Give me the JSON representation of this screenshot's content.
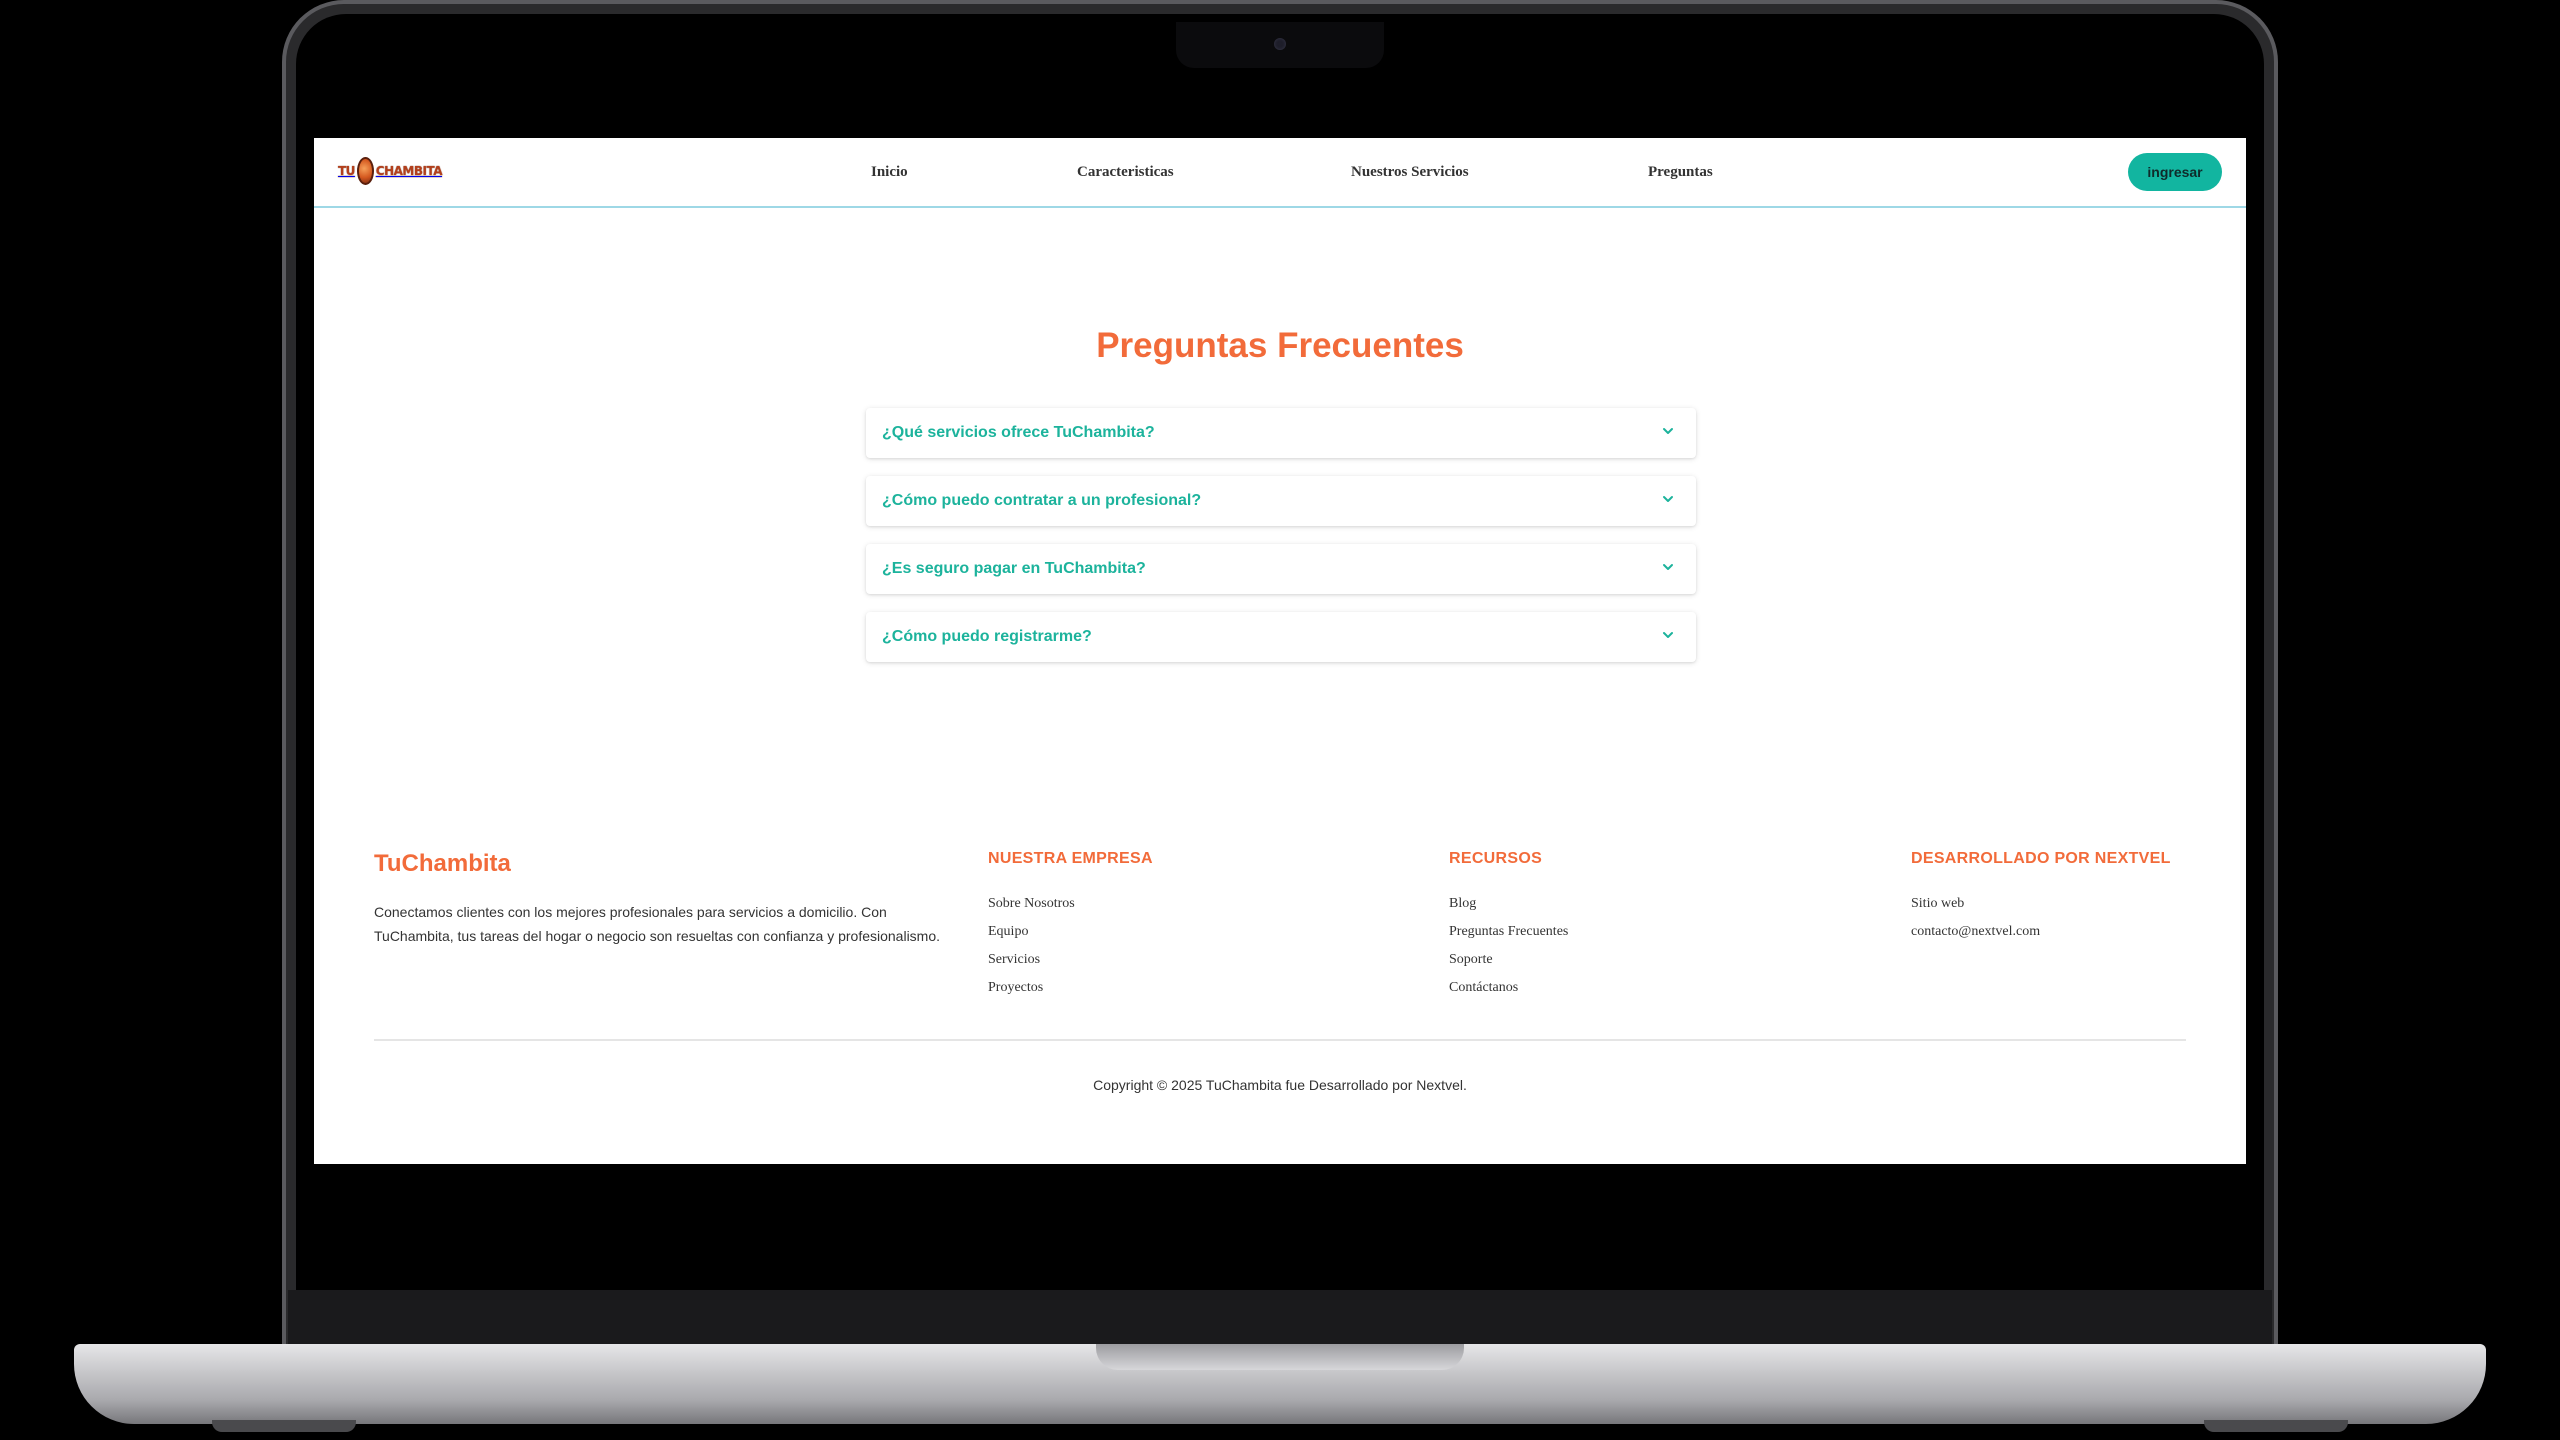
{
  "nav": {
    "logo_text_left": "TU",
    "logo_text_right": "CHAMBITA",
    "links": [
      "Inicio",
      "Caracteristicas",
      "Nuestros Servicios",
      "Preguntas"
    ],
    "login_label": "ingresar"
  },
  "faq": {
    "title": "Preguntas Frecuentes",
    "items": [
      "¿Qué servicios ofrece TuChambita?",
      "¿Cómo puedo contratar a un profesional?",
      "¿Es seguro pagar en TuChambita?",
      "¿Cómo puedo registrarme?"
    ]
  },
  "footer": {
    "brand": "TuChambita",
    "description": "Conectamos clientes con los mejores profesionales para servicios a domicilio. Con TuChambita, tus tareas del hogar o negocio son resueltas con confianza y profesionalismo.",
    "columns": [
      {
        "title": "NUESTRA EMPRESA",
        "links": [
          "Sobre Nosotros",
          "Equipo",
          "Servicios",
          "Proyectos"
        ]
      },
      {
        "title": "RECURSOS",
        "links": [
          "Blog",
          "Preguntas Frecuentes",
          "Soporte",
          "Contáctanos"
        ]
      },
      {
        "title": "DESARROLLADO POR NEXTVEL",
        "links": [
          "Sitio web",
          "contacto@nextvel.com"
        ]
      }
    ],
    "copyright": "Copyright © 2025 TuChambita fue Desarrollado por Nextvel."
  },
  "colors": {
    "accent_orange": "#f26b3a",
    "accent_teal": "#1cb39c",
    "button_teal": "#12b5a0"
  },
  "icons": {
    "faq_toggle": "chevron-down-icon",
    "logo": "tuchambita-logo"
  }
}
